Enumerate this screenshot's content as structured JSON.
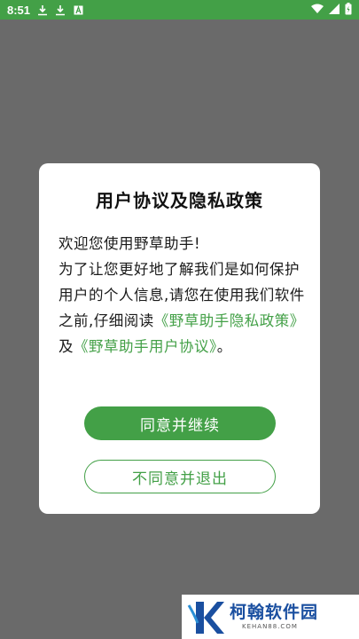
{
  "status_bar": {
    "time": "8:51",
    "icons": [
      "download-icon",
      "download-icon",
      "a-badge-icon",
      "wifi-icon",
      "signal-icon",
      "battery-charging-icon"
    ]
  },
  "dialog": {
    "title": "用户协议及隐私政策",
    "greeting": "欢迎您使用野草助手!",
    "body_text": "为了让您更好地了解我们是如何保护用户的个人信息,请您在使用我们软件之前,仔细阅读",
    "privacy_link": "《野草助手隐私政策》",
    "conjunction": "及",
    "agreement_link": "《野草助手用户协议》",
    "ending": "。",
    "agree_button": "同意并继续",
    "disagree_button": "不同意并退出"
  },
  "watermark": {
    "name": "柯翰软件园",
    "domain": "KEHAN88.COM"
  },
  "colors": {
    "accent": "#43a047",
    "scrim": "#6a6a6a",
    "dialog_bg": "#ffffff",
    "watermark_blue": "#1a4fa0"
  }
}
